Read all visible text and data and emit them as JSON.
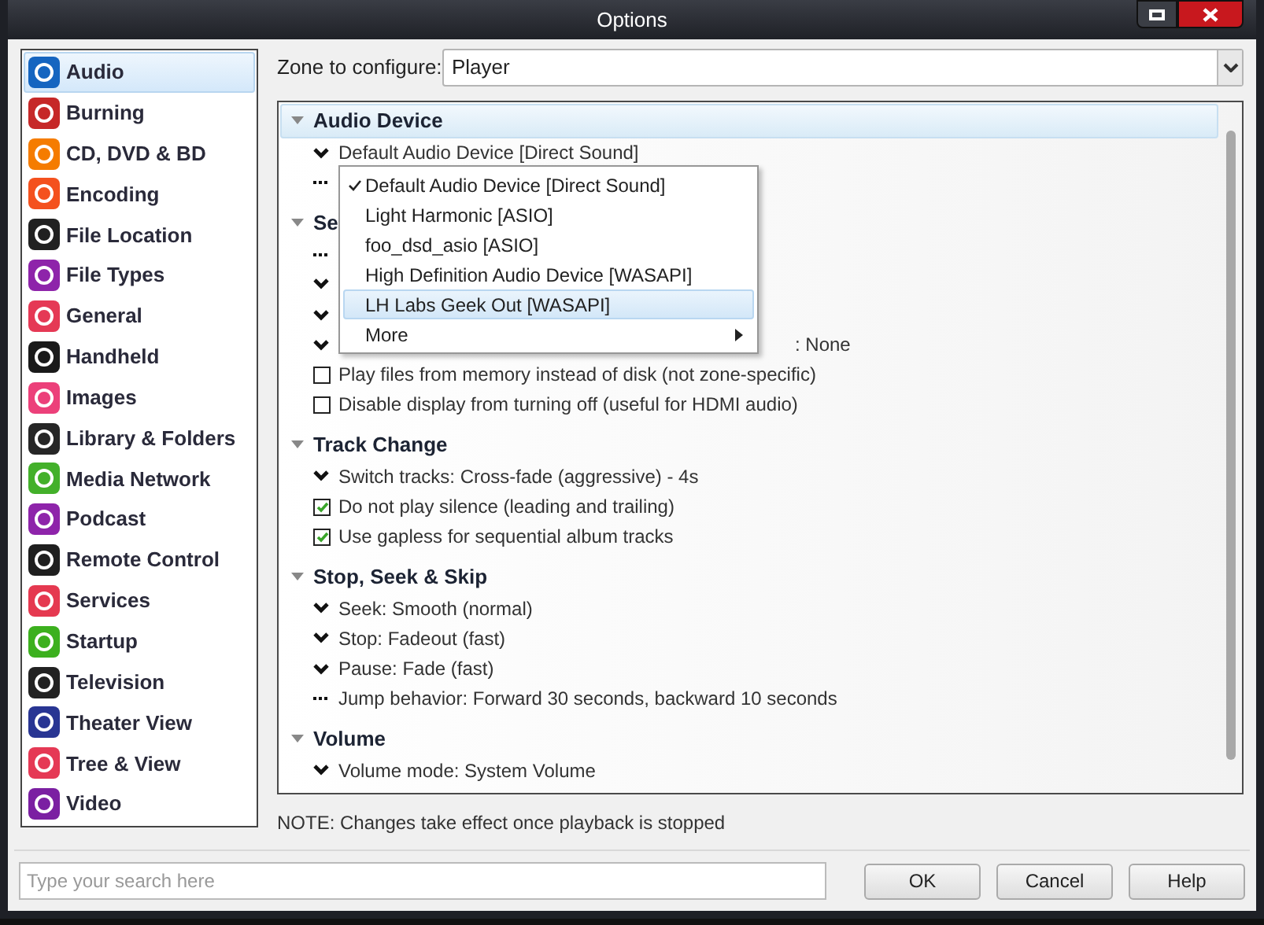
{
  "window": {
    "title": "Options"
  },
  "sidebar": {
    "items": [
      {
        "label": "Audio",
        "selected": true,
        "color": "#1565c0"
      },
      {
        "label": "Burning",
        "selected": false,
        "color": "#c62828"
      },
      {
        "label": "CD, DVD & BD",
        "selected": false,
        "color": "#f57c00"
      },
      {
        "label": "Encoding",
        "selected": false,
        "color": "#f4511e"
      },
      {
        "label": "File Location",
        "selected": false,
        "color": "#212121"
      },
      {
        "label": "File Types",
        "selected": false,
        "color": "#8e24aa"
      },
      {
        "label": "General",
        "selected": false,
        "color": "#e53955"
      },
      {
        "label": "Handheld",
        "selected": false,
        "color": "#1a1a1a"
      },
      {
        "label": "Images",
        "selected": false,
        "color": "#ec407a"
      },
      {
        "label": "Library & Folders",
        "selected": false,
        "color": "#262626"
      },
      {
        "label": "Media Network",
        "selected": false,
        "color": "#43b02a"
      },
      {
        "label": "Podcast",
        "selected": false,
        "color": "#8e24aa"
      },
      {
        "label": "Remote Control",
        "selected": false,
        "color": "#1f1f1f"
      },
      {
        "label": "Services",
        "selected": false,
        "color": "#e53950"
      },
      {
        "label": "Startup",
        "selected": false,
        "color": "#3cb01e"
      },
      {
        "label": "Television",
        "selected": false,
        "color": "#222222"
      },
      {
        "label": "Theater View",
        "selected": false,
        "color": "#283593"
      },
      {
        "label": "Tree & View",
        "selected": false,
        "color": "#e53955"
      },
      {
        "label": "Video",
        "selected": false,
        "color": "#7b1fa2"
      }
    ]
  },
  "zone": {
    "label": "Zone to configure:",
    "value": "Player"
  },
  "sections": [
    {
      "title": "Audio Device",
      "selected": true,
      "rows": [
        {
          "kind": "dropdown",
          "text": "Default Audio Device [Direct Sound]"
        },
        {
          "kind": "action"
        }
      ]
    },
    {
      "title": "Se",
      "selected": false,
      "rows": [
        {
          "kind": "action"
        },
        {
          "kind": "dropdown"
        },
        {
          "kind": "dropdown"
        },
        {
          "kind": "dropdown",
          "text": ": None"
        },
        {
          "kind": "checkbox",
          "text": "Play files from memory instead of disk (not zone-specific)",
          "checked": false
        },
        {
          "kind": "checkbox",
          "text": "Disable display from turning off (useful for HDMI audio)",
          "checked": false
        }
      ]
    },
    {
      "title": "Track Change",
      "selected": false,
      "rows": [
        {
          "kind": "dropdown",
          "text": "Switch tracks: Cross-fade (aggressive) - 4s"
        },
        {
          "kind": "checkbox",
          "text": "Do not play silence (leading and trailing)",
          "checked": true
        },
        {
          "kind": "checkbox",
          "text": "Use gapless for sequential album tracks",
          "checked": true
        }
      ]
    },
    {
      "title": "Stop, Seek & Skip",
      "selected": false,
      "rows": [
        {
          "kind": "dropdown",
          "text": "Seek: Smooth (normal)"
        },
        {
          "kind": "dropdown",
          "text": "Stop: Fadeout (fast)"
        },
        {
          "kind": "dropdown",
          "text": "Pause: Fade (fast)"
        },
        {
          "kind": "action",
          "text": "Jump behavior: Forward 30 seconds, backward 10 seconds"
        }
      ]
    },
    {
      "title": "Volume",
      "selected": false,
      "rows": [
        {
          "kind": "dropdown",
          "text": "Volume mode: System Volume"
        }
      ]
    }
  ],
  "menu": {
    "items": [
      {
        "label": "Default Audio Device [Direct Sound]",
        "checked": true,
        "selected": false
      },
      {
        "label": "Light Harmonic [ASIO]",
        "checked": false,
        "selected": false
      },
      {
        "label": "foo_dsd_asio [ASIO]",
        "checked": false,
        "selected": false
      },
      {
        "label": "High Definition Audio Device [WASAPI]",
        "checked": false,
        "selected": false
      },
      {
        "label": "LH Labs Geek Out [WASAPI]",
        "checked": false,
        "selected": true
      },
      {
        "label": "More",
        "checked": false,
        "selected": false,
        "submenu": true
      }
    ]
  },
  "note": "NOTE: Changes take effect once playback is stopped",
  "search": {
    "placeholder": "Type your search here"
  },
  "buttons": [
    "OK",
    "Cancel",
    "Help"
  ]
}
